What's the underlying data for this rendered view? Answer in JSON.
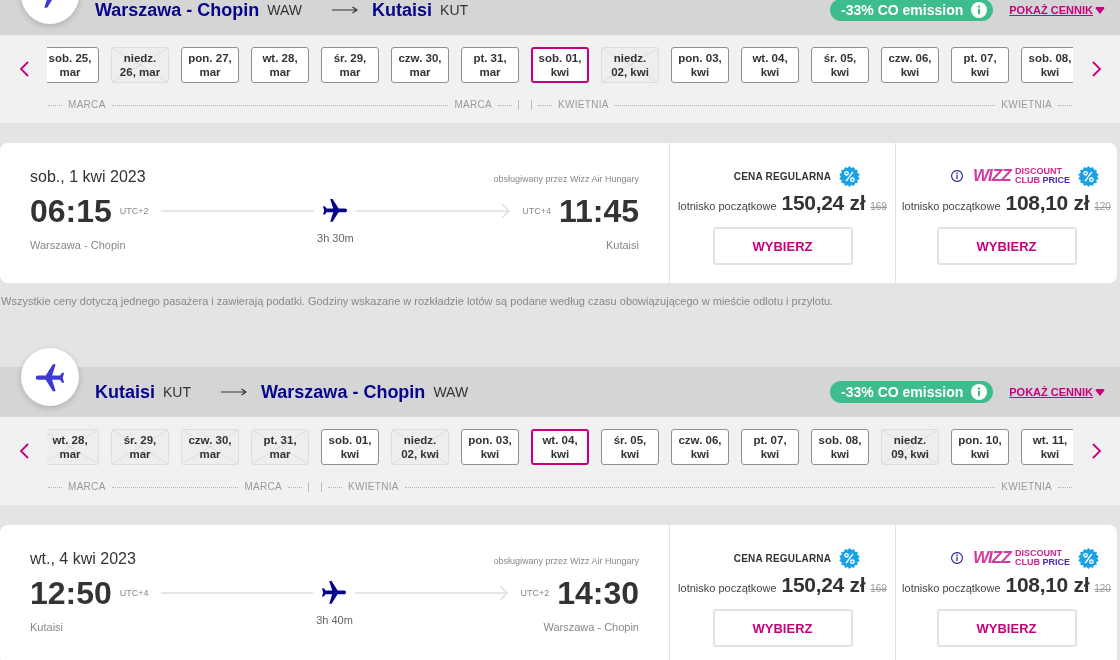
{
  "sections": [
    {
      "kind": "outbound",
      "route": {
        "origin": {
          "city": "Warszawa - Chopin",
          "code": "WAW"
        },
        "destination": {
          "city": "Kutaisi",
          "code": "KUT"
        }
      },
      "emission": "-33% CO emission",
      "price_link": "POKAŻ CENNIK",
      "date_strip": {
        "months": [
          {
            "labels": [
              "MARCA",
              "MARCA"
            ],
            "dates": [
              {
                "lines": [
                  "sob. 25,",
                  "mar"
                ],
                "available": true,
                "selected": false
              },
              {
                "lines": [
                  "niedz.",
                  "26, mar"
                ],
                "available": false,
                "selected": false
              },
              {
                "lines": [
                  "pon. 27,",
                  "mar"
                ],
                "available": true,
                "selected": false
              },
              {
                "lines": [
                  "wt. 28,",
                  "mar"
                ],
                "available": true,
                "selected": false
              },
              {
                "lines": [
                  "śr. 29,",
                  "mar"
                ],
                "available": true,
                "selected": false
              },
              {
                "lines": [
                  "czw. 30,",
                  "mar"
                ],
                "available": true,
                "selected": false
              },
              {
                "lines": [
                  "pt. 31,",
                  "mar"
                ],
                "available": true,
                "selected": false
              }
            ]
          },
          {
            "labels": [
              "KWIETNIA",
              "KWIETNIA"
            ],
            "dates": [
              {
                "lines": [
                  "sob. 01,",
                  "kwi"
                ],
                "available": true,
                "selected": true
              },
              {
                "lines": [
                  "niedz.",
                  "02, kwi"
                ],
                "available": false,
                "selected": false
              },
              {
                "lines": [
                  "pon. 03,",
                  "kwi"
                ],
                "available": true,
                "selected": false
              },
              {
                "lines": [
                  "wt. 04,",
                  "kwi"
                ],
                "available": true,
                "selected": false
              },
              {
                "lines": [
                  "śr. 05,",
                  "kwi"
                ],
                "available": true,
                "selected": false
              },
              {
                "lines": [
                  "czw. 06,",
                  "kwi"
                ],
                "available": true,
                "selected": false
              },
              {
                "lines": [
                  "pt. 07,",
                  "kwi"
                ],
                "available": true,
                "selected": false
              },
              {
                "lines": [
                  "sob. 08,",
                  "kwi"
                ],
                "available": true,
                "selected": false
              }
            ]
          }
        ]
      },
      "flight": {
        "date": "sob., 1 kwi 2023",
        "operator": "obsługiwany przez Wizz Air Hungary",
        "departure": {
          "time": "06:15",
          "utc": "UTC+2",
          "airport": "Warszawa - Chopin"
        },
        "arrival": {
          "time": "11:45",
          "utc": "UTC+4",
          "airport": "Kutaisi"
        },
        "duration": "3h 30m",
        "fares": [
          {
            "kind": "regular",
            "title": "CENA REGULARNA",
            "note": "lotnisko początkowe",
            "price": "150,24 zł",
            "old_price": "169",
            "button": "WYBIERZ"
          },
          {
            "kind": "club",
            "logo": {
              "brand": "WIZZ",
              "words": [
                "DISCOUNT",
                "CLUB",
                "PRICE"
              ]
            },
            "note": "lotnisko początkowe",
            "price": "108,10 zł",
            "old_price": "120",
            "button": "WYBIERZ"
          }
        ]
      },
      "disclaimer": "Wszystkie ceny dotyczą jednego pasażera i zawierają podatki. Godziny wskazane w rozkładzie lotów są podane według czasu obowiązującego w mieście odlotu i przylotu."
    },
    {
      "kind": "return",
      "route": {
        "origin": {
          "city": "Kutaisi",
          "code": "KUT"
        },
        "destination": {
          "city": "Warszawa - Chopin",
          "code": "WAW"
        }
      },
      "emission": "-33% CO emission",
      "price_link": "POKAŻ CENNIK",
      "date_strip": {
        "months": [
          {
            "labels": [
              "MARCA",
              "MARCA"
            ],
            "dates": [
              {
                "lines": [
                  "wt. 28,",
                  "mar"
                ],
                "available": false,
                "selected": false
              },
              {
                "lines": [
                  "śr. 29,",
                  "mar"
                ],
                "available": false,
                "selected": false
              },
              {
                "lines": [
                  "czw. 30,",
                  "mar"
                ],
                "available": false,
                "selected": false
              },
              {
                "lines": [
                  "pt. 31,",
                  "mar"
                ],
                "available": false,
                "selected": false
              }
            ]
          },
          {
            "labels": [
              "KWIETNIA",
              "KWIETNIA"
            ],
            "dates": [
              {
                "lines": [
                  "sob. 01,",
                  "kwi"
                ],
                "available": true,
                "selected": false
              },
              {
                "lines": [
                  "niedz.",
                  "02, kwi"
                ],
                "available": false,
                "selected": false
              },
              {
                "lines": [
                  "pon. 03,",
                  "kwi"
                ],
                "available": true,
                "selected": false
              },
              {
                "lines": [
                  "wt. 04,",
                  "kwi"
                ],
                "available": true,
                "selected": true
              },
              {
                "lines": [
                  "śr. 05,",
                  "kwi"
                ],
                "available": true,
                "selected": false
              },
              {
                "lines": [
                  "czw. 06,",
                  "kwi"
                ],
                "available": true,
                "selected": false
              },
              {
                "lines": [
                  "pt. 07,",
                  "kwi"
                ],
                "available": true,
                "selected": false
              },
              {
                "lines": [
                  "sob. 08,",
                  "kwi"
                ],
                "available": true,
                "selected": false
              },
              {
                "lines": [
                  "niedz.",
                  "09, kwi"
                ],
                "available": false,
                "selected": false
              },
              {
                "lines": [
                  "pon. 10,",
                  "kwi"
                ],
                "available": true,
                "selected": false
              },
              {
                "lines": [
                  "wt. 11,",
                  "kwi"
                ],
                "available": true,
                "selected": false
              }
            ]
          }
        ]
      },
      "flight": {
        "date": "wt., 4 kwi 2023",
        "operator": "obsługiwany przez Wizz Air Hungary",
        "departure": {
          "time": "12:50",
          "utc": "UTC+4",
          "airport": "Kutaisi"
        },
        "arrival": {
          "time": "14:30",
          "utc": "UTC+2",
          "airport": "Warszawa - Chopin"
        },
        "duration": "3h 40m",
        "fares": [
          {
            "kind": "regular",
            "title": "CENA REGULARNA",
            "note": "lotnisko początkowe",
            "price": "150,24 zł",
            "old_price": "169",
            "button": "WYBIERZ"
          },
          {
            "kind": "club",
            "logo": {
              "brand": "WIZZ",
              "words": [
                "DISCOUNT",
                "CLUB",
                "PRICE"
              ]
            },
            "note": "lotnisko początkowe",
            "price": "108,10 zł",
            "old_price": "120",
            "button": "WYBIERZ"
          }
        ]
      }
    }
  ]
}
